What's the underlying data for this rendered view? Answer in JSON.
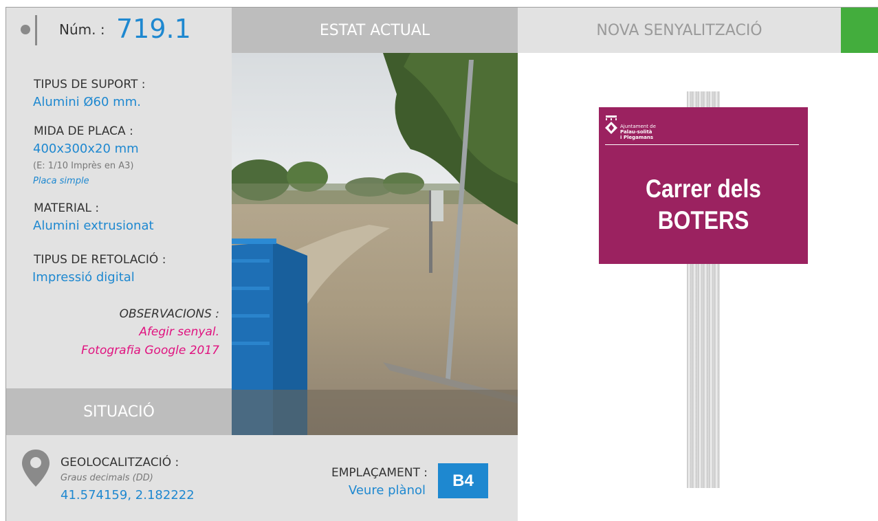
{
  "header": {
    "num_label": "Núm. :",
    "num_value": "719.1",
    "current_state": "ESTAT ACTUAL",
    "new_signage": "NOVA SENYALITZACIÓ"
  },
  "info": {
    "support_label": "TIPUS DE SUPORT :",
    "support_value": "Alumini Ø60 mm.",
    "plate_size_label": "MIDA DE PLACA :",
    "plate_size_value": "400x300x20 mm",
    "plate_scale": "(E: 1/10 Imprès en A3)",
    "plate_type": "Placa simple",
    "material_label": "MATERIAL :",
    "material_value": "Alumini extrusionat",
    "lettering_label": "TIPUS DE RETOLACIÓ :",
    "lettering_value": "Impressió digital",
    "observations_label": "OBSERVACIONS :",
    "observations_line1": "Afegir senyal.",
    "observations_line2": "Fotografia Google 2017"
  },
  "situation": {
    "title": "SITUACIÓ",
    "geo_label": "GEOLOCALITZACIÓ :",
    "geo_format": "Graus decimals (DD)",
    "geo_coords": "41.574159, 2.182222",
    "location_label": "EMPLAÇAMENT :",
    "location_link": "Veure plànol",
    "grid_ref": "B4"
  },
  "sign": {
    "org_line1": "Ajuntament de",
    "org_line2": "Palau-solità",
    "org_line3": "i Plegamans",
    "street_line1": "Carrer dels",
    "street_line2": "BOTERS"
  },
  "colors": {
    "accent_blue": "#1e88d0",
    "observation_pink": "#e0127f",
    "sign_purple": "#9b2260",
    "green_block": "#43ad3d"
  }
}
